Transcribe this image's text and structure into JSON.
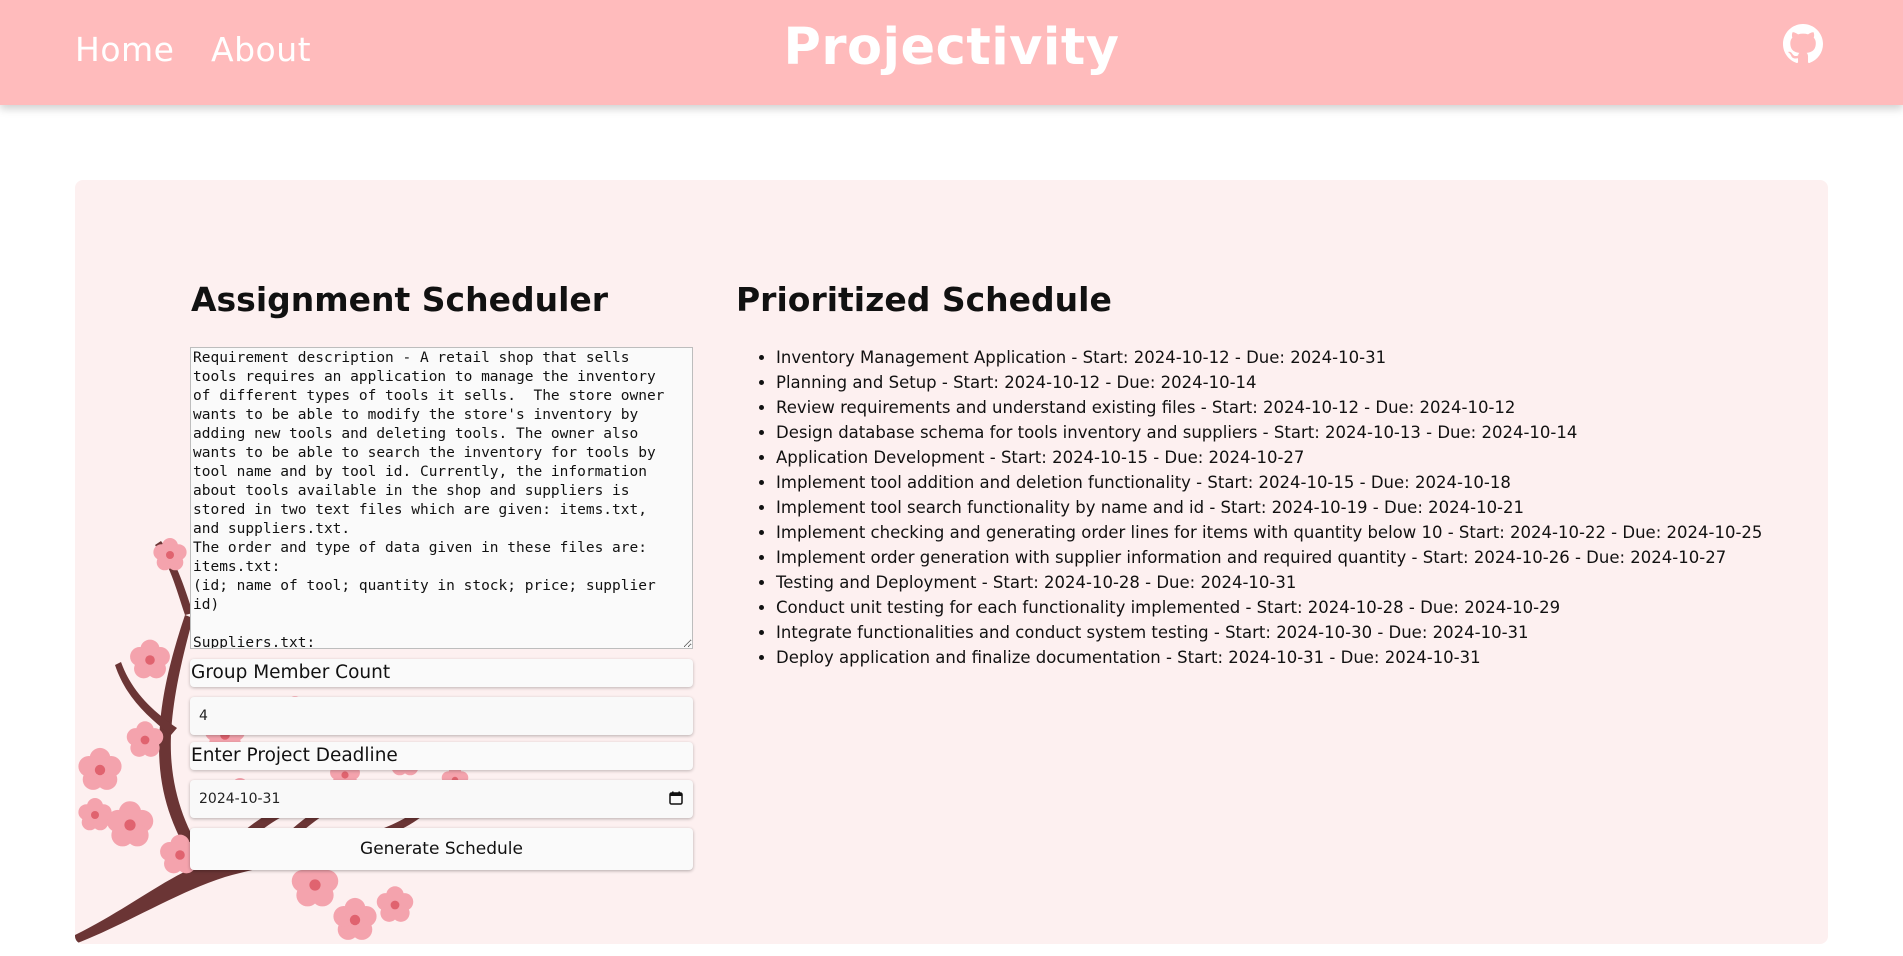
{
  "nav": {
    "home": "Home",
    "about": "About",
    "brand": "Projectivity",
    "github_icon": "github-icon"
  },
  "left": {
    "title": "Assignment Scheduler",
    "requirement_text": "Requirement description - A retail shop that sells tools requires an application to manage the inventory of different types of tools it sells.  The store owner wants to be able to modify the store's inventory by adding new tools and deleting tools. The owner also wants to be able to search the inventory for tools by tool name and by tool id. Currently, the information about tools available in the shop and suppliers is stored in two text files which are given: items.txt, and suppliers.txt.\nThe order and type of data given in these files are:\nitems.txt:\n(id; name of tool; quantity in stock; price; supplier id)\n\nSuppliers.txt:",
    "group_label": "Group Member Count",
    "group_value": "4",
    "deadline_label": "Enter Project Deadline",
    "deadline_value": "2024-10-31",
    "generate_label": "Generate Schedule"
  },
  "right": {
    "title": "Prioritized Schedule",
    "items": [
      "Inventory Management Application - Start: 2024-10-12 - Due: 2024-10-31",
      "Planning and Setup - Start: 2024-10-12 - Due: 2024-10-14",
      "Review requirements and understand existing files - Start: 2024-10-12 - Due: 2024-10-12",
      "Design database schema for tools inventory and suppliers - Start: 2024-10-13 - Due: 2024-10-14",
      "Application Development - Start: 2024-10-15 - Due: 2024-10-27",
      "Implement tool addition and deletion functionality - Start: 2024-10-15 - Due: 2024-10-18",
      "Implement tool search functionality by name and id - Start: 2024-10-19 - Due: 2024-10-21",
      "Implement checking and generating order lines for items with quantity below 10 - Start: 2024-10-22 - Due: 2024-10-25",
      "Implement order generation with supplier information and required quantity - Start: 2024-10-26 - Due: 2024-10-27",
      "Testing and Deployment - Start: 2024-10-28 - Due: 2024-10-31",
      "Conduct unit testing for each functionality implemented - Start: 2024-10-28 - Due: 2024-10-29",
      "Integrate functionalities and conduct system testing - Start: 2024-10-30 - Due: 2024-10-31",
      "Deploy application and finalize documentation - Start: 2024-10-31 - Due: 2024-10-31"
    ]
  },
  "colors": {
    "navbar": "#ffbbbc",
    "panel": "#fdf0f0",
    "branch": "#6b3535",
    "blossom": "#f4a3ad"
  }
}
